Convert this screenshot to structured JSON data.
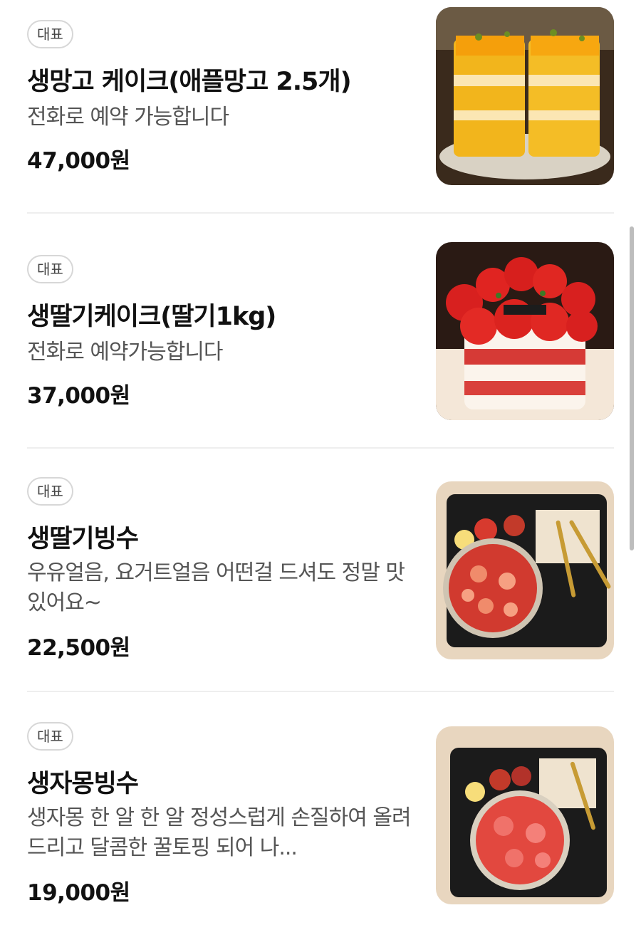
{
  "menu": [
    {
      "badge": "대표",
      "name": "생망고 케이크(애플망고 2.5개)",
      "description": "전화로 예약 가능합니다",
      "price": "47,000원",
      "image_icon": "mango-cake-photo"
    },
    {
      "badge": "대표",
      "name": "생딸기케이크(딸기1kg)",
      "description": "전화로 예약가능합니다",
      "price": "37,000원",
      "image_icon": "strawberry-cake-photo"
    },
    {
      "badge": "대표",
      "name": "생딸기빙수",
      "description": "우유얼음, 요거트얼음 어떤걸 드셔도 정말 맛있어요~",
      "price": "22,500원",
      "image_icon": "strawberry-bingsu-photo"
    },
    {
      "badge": "대표",
      "name": "생자몽빙수",
      "description": "생자몽 한 알 한 알 정성스럽게 손질하여 올려드리고 달콤한 꿀토핑 되어 나...",
      "price": "19,000원",
      "image_icon": "grapefruit-bingsu-photo"
    }
  ]
}
